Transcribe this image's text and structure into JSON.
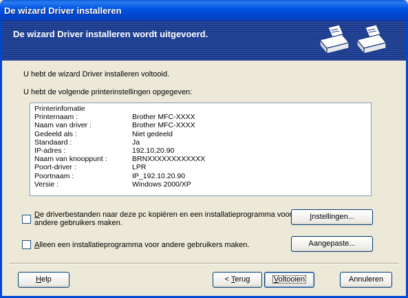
{
  "window": {
    "title": "De wizard Driver installeren"
  },
  "banner": {
    "heading": "De wizard Driver installeren wordt uitgevoerd."
  },
  "main": {
    "complete_text": "U hebt de wizard Driver installeren voltooid.",
    "settings_intro": "U hebt de volgende printerinstellingen opgegeven:",
    "list_header": "Printerinfomatie",
    "settings": [
      {
        "key": "Printernaam :",
        "value": "Brother MFC-XXXX"
      },
      {
        "key": "Naam van driver :",
        "value": "Brother MFC-XXXX"
      },
      {
        "key": "Gedeeld als :",
        "value": "Niet gedeeld"
      },
      {
        "key": "Standaard :",
        "value": "Ja"
      },
      {
        "key": "IP-adres :",
        "value": "192.10.20.90"
      },
      {
        "key": "Naam van knooppunt :",
        "value": "BRNXXXXXXXXXXXX"
      },
      {
        "key": "Poort-driver :",
        "value": "LPR"
      },
      {
        "key": "Poortnaam :",
        "value": "IP_192.10.20.90"
      },
      {
        "key": "Versie :",
        "value": "Windows 2000/XP"
      }
    ]
  },
  "options": {
    "copy_files": {
      "label_line1_accel": "D",
      "label_line1_rest": "e driverbestanden naar deze pc kopiëren en een installatieprogramma voor",
      "label_line2": "andere gebruikers maken.",
      "checked": false
    },
    "installer_only": {
      "label_accel": "A",
      "label_rest": "lleen een installatieprogramma voor andere gebruikers maken.",
      "checked": false
    },
    "settings_button": {
      "accel": "I",
      "rest": "nstellingen..."
    },
    "custom_button": {
      "pre": "Aan",
      "accel": "g",
      "rest": "epaste..."
    }
  },
  "footer": {
    "help": {
      "accel": "H",
      "rest": "elp"
    },
    "back": {
      "pre": "< ",
      "accel": "T",
      "rest": "erug"
    },
    "finish": {
      "accel": "V",
      "rest": "oltooien"
    },
    "cancel": "Annuleren"
  }
}
